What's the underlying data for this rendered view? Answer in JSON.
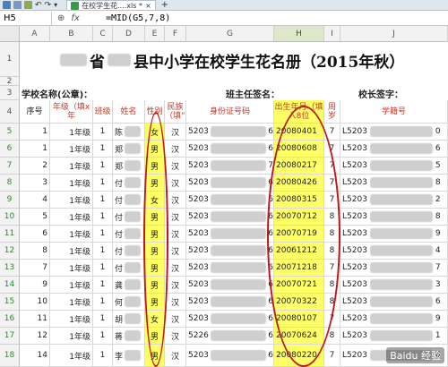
{
  "toolbar": {
    "file_tab": "在校学生花....xls *",
    "add_tab": "+"
  },
  "formula_bar": {
    "name_box": "H5",
    "formula": "=MID(G5,7,8)"
  },
  "columns": [
    "A",
    "B",
    "C",
    "D",
    "E",
    "F",
    "G",
    "H",
    "I",
    "J"
  ],
  "selected_column": "H",
  "rows": [
    "1",
    "2",
    "3",
    "4",
    "5",
    "6",
    "7",
    "8",
    "9",
    "10",
    "11",
    "12",
    "13",
    "14",
    "15",
    "16",
    "17",
    "18"
  ],
  "sheet": {
    "title_province_suffix": "省",
    "title_text": "县中小学在校学生花名册（2015年秋）",
    "school_label": "学校名称(公章)：",
    "teacher_sign_label": "班主任签名：",
    "principal_sign_label": "校长签字：",
    "headers": {
      "seq": "序号",
      "grade": "年级（填x年",
      "class": "班级",
      "name": "姓名",
      "gender": "性别",
      "ethnic": "民族（填“",
      "idcard": "身份证号码",
      "birth": "出生年月（填入8位",
      "age": "周岁",
      "student_id": "学籍号"
    },
    "records": [
      {
        "seq": "1",
        "grade": "1年级",
        "class": "1",
        "name": "陈",
        "gender": "女",
        "ethnic": "汉",
        "id_prefix": "5203",
        "id_last": "6",
        "birth": "20080401",
        "age": "7",
        "sid_prefix": "L5203",
        "sid_last": "0"
      },
      {
        "seq": "1",
        "grade": "1年级",
        "class": "1",
        "name": "郑",
        "gender": "男",
        "ethnic": "汉",
        "id_prefix": "5203",
        "id_last": "6",
        "birth": "20080608",
        "age": "7",
        "sid_prefix": "L5203",
        "sid_last": "6"
      },
      {
        "seq": "2",
        "grade": "1年级",
        "class": "1",
        "name": "郑",
        "gender": "男",
        "ethnic": "汉",
        "id_prefix": "5203",
        "id_last": "7",
        "birth": "20080217",
        "age": "7",
        "sid_prefix": "L5203",
        "sid_last": "5"
      },
      {
        "seq": "3",
        "grade": "1年级",
        "class": "1",
        "name": "付",
        "gender": "男",
        "ethnic": "汉",
        "id_prefix": "5203",
        "id_last": "6",
        "birth": "20080426",
        "age": "7",
        "sid_prefix": "L5203",
        "sid_last": "8"
      },
      {
        "seq": "4",
        "grade": "1年级",
        "class": "1",
        "name": "付",
        "gender": "女",
        "ethnic": "汉",
        "id_prefix": "5203",
        "id_last": "6",
        "birth": "20080315",
        "age": "7",
        "sid_prefix": "L5203",
        "sid_last": "2"
      },
      {
        "seq": "5",
        "grade": "1年级",
        "class": "1",
        "name": "付",
        "gender": "男",
        "ethnic": "汉",
        "id_prefix": "5203",
        "id_last": "6",
        "birth": "20070712",
        "age": "8",
        "sid_prefix": "L5203",
        "sid_last": "8"
      },
      {
        "seq": "6",
        "grade": "1年级",
        "class": "1",
        "name": "付",
        "gender": "男",
        "ethnic": "汉",
        "id_prefix": "5203",
        "id_last": "6",
        "birth": "20070719",
        "age": "8",
        "sid_prefix": "L5203",
        "sid_last": "9"
      },
      {
        "seq": "8",
        "grade": "1年级",
        "class": "1",
        "name": "付",
        "gender": "男",
        "ethnic": "汉",
        "id_prefix": "5203",
        "id_last": "6",
        "birth": "20061212",
        "age": "8",
        "sid_prefix": "L5203",
        "sid_last": "4"
      },
      {
        "seq": "7",
        "grade": "1年级",
        "class": "1",
        "name": "付",
        "gender": "男",
        "ethnic": "汉",
        "id_prefix": "5203",
        "id_last": "6",
        "birth": "20071218",
        "age": "7",
        "sid_prefix": "L5203",
        "sid_last": "7"
      },
      {
        "seq": "9",
        "grade": "1年级",
        "class": "1",
        "name": "龚",
        "gender": "男",
        "ethnic": "汉",
        "id_prefix": "5203",
        "id_last": "6",
        "birth": "20070721",
        "age": "8",
        "sid_prefix": "L5203",
        "sid_last": "3"
      },
      {
        "seq": "10",
        "grade": "1年级",
        "class": "1",
        "name": "何",
        "gender": "男",
        "ethnic": "汉",
        "id_prefix": "5203",
        "id_last": "6",
        "birth": "20070322",
        "age": "8",
        "sid_prefix": "L5203",
        "sid_last": "6"
      },
      {
        "seq": "11",
        "grade": "1年级",
        "class": "1",
        "name": "胡",
        "gender": "女",
        "ethnic": "汉",
        "id_prefix": "5203",
        "id_last": "6",
        "birth": "20080107",
        "age": "7",
        "sid_prefix": "L5203",
        "sid_last": "9"
      },
      {
        "seq": "12",
        "grade": "1年级",
        "class": "1",
        "name": "蒋",
        "gender": "男",
        "ethnic": "汉",
        "id_prefix": "5226",
        "id_last": "6",
        "birth": "20070624",
        "age": "8",
        "sid_prefix": "L5203",
        "sid_last": "1"
      },
      {
        "seq": "14",
        "grade": "1年级",
        "class": "1",
        "name": "李",
        "gender": "男",
        "ethnic": "汉",
        "id_prefix": "5203",
        "id_last": "6",
        "birth": "20080220",
        "age": "7",
        "sid_prefix": "L5203",
        "sid_last": "6"
      }
    ]
  },
  "watermark": "Baidu 经验",
  "colors": {
    "highlight": "#ffff66",
    "annotation": "#c0151a",
    "header_text": "#c0392b",
    "selected_header": "#dce8c8"
  }
}
